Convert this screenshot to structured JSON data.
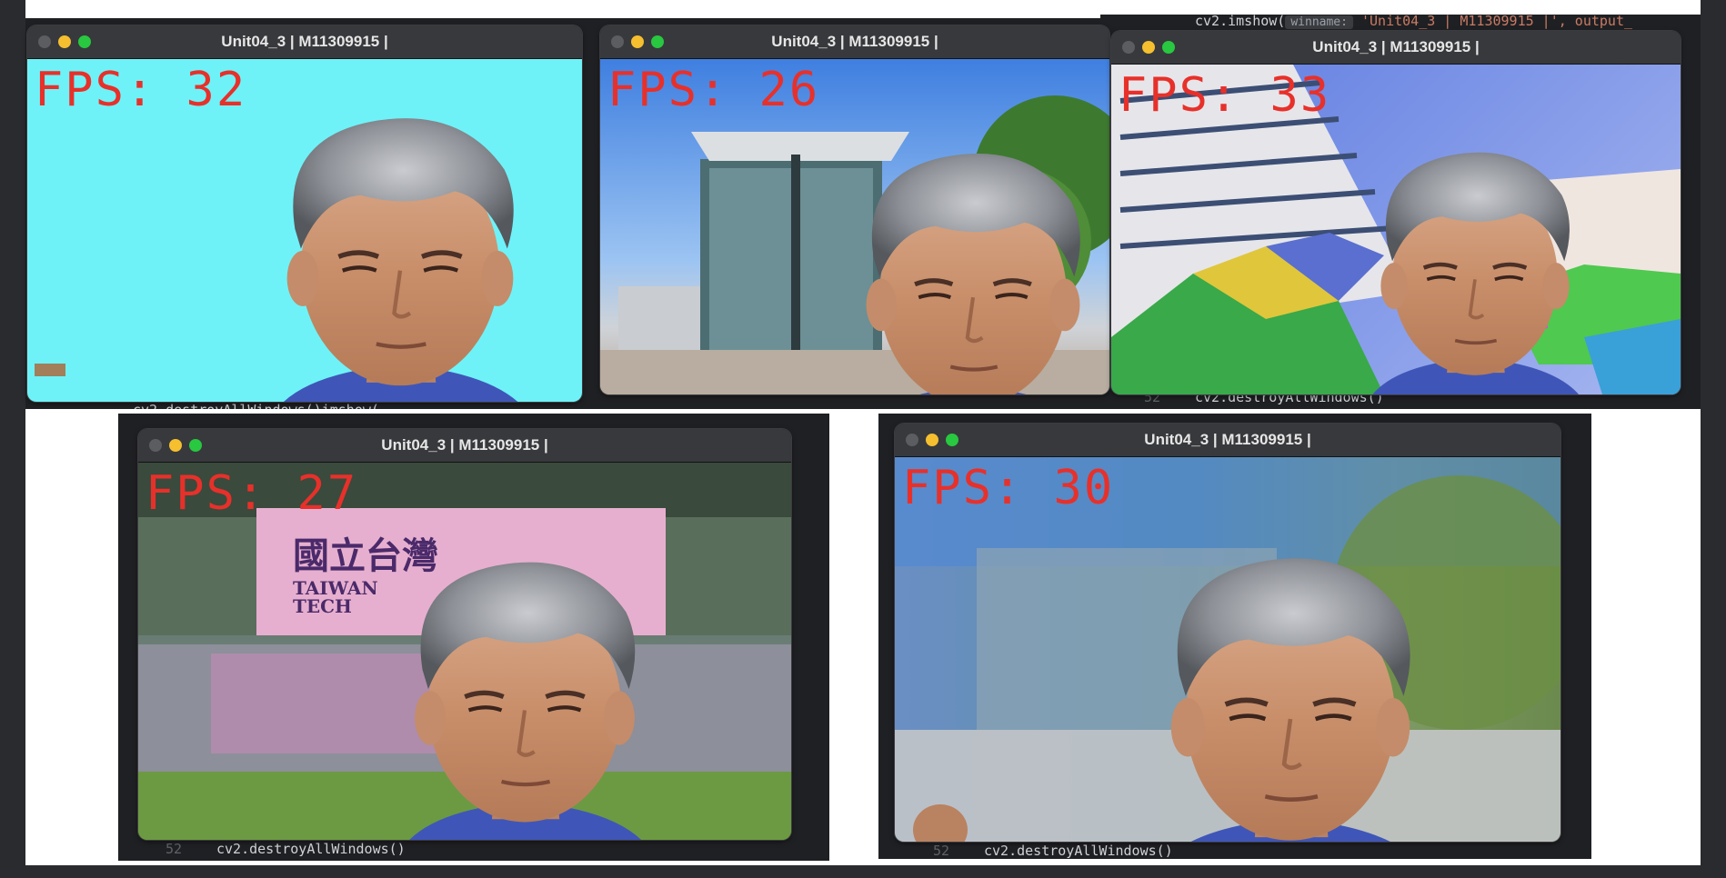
{
  "window_title": "Unit04_3 | M11309915 |",
  "code": {
    "destroy_call": "cv2.destroyAllWindows()",
    "line_num": "52",
    "imshow_prefix": "cv2.imshow(",
    "imshow_chip": "winname:",
    "imshow_rest": "'Unit04_3 | M11309915 |', output_",
    "partial_line_a": "cv2.destroyAllWindows()imshow(",
    "partial_line_b": "'Unit04_3 | M11309915 |', output_"
  },
  "windows": [
    {
      "fps_label": "FPS: 32",
      "background": "solid cyan",
      "bg_color": "#6ef2f8"
    },
    {
      "fps_label": "FPS: 26",
      "background": "glass building with trees"
    },
    {
      "fps_label": "FPS: 33",
      "background": "colorful tall building"
    },
    {
      "fps_label": "FPS: 27",
      "background": "Taiwan Tech sign with pond",
      "sign_line1": "國立台灣",
      "sign_line2": "TAIWAN",
      "sign_line3": "TECH"
    },
    {
      "fps_label": "FPS: 30",
      "background": "blurred outdoor scene"
    }
  ],
  "colors": {
    "fps_text": "#e8302a",
    "titlebar": "#38393c",
    "editor_bg": "#1f2023",
    "close": "#5c5d60",
    "minimize": "#f5bf2f",
    "maximize": "#28c840"
  }
}
